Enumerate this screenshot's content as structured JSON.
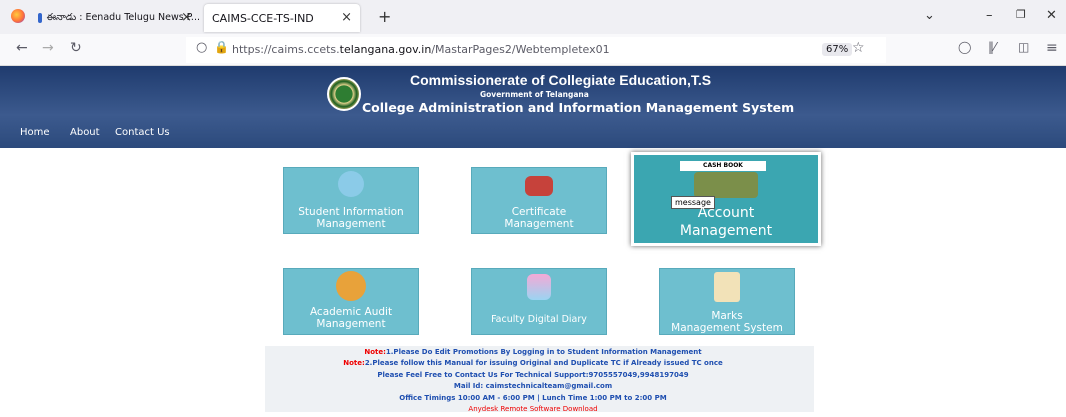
{
  "browser": {
    "tabs": [
      {
        "label": "ఈనాడు : Eenadu Telugu News P...",
        "close": "×"
      },
      {
        "label": "CAIMS-CCE-TS-IND",
        "close": "×"
      }
    ],
    "new_tab": "+",
    "url_host": "https://caims.ccets.",
    "url_domain": "telangana.gov.in",
    "url_path": "/MastarPages2/Webtempletex01",
    "zoom": "67%"
  },
  "header": {
    "title": "Commissionerate of Collegiate Education,T.S",
    "subtitle": "Government of Telangana",
    "system": "College Administration and Information Management System"
  },
  "menu": [
    "Home",
    "About",
    "Contact Us"
  ],
  "tiles": {
    "student": [
      "Student Information",
      "Management"
    ],
    "certificate": [
      "Certificate",
      "Management"
    ],
    "account": {
      "badge": "CASH BOOK",
      "tooltip": "message",
      "lines": [
        "Account",
        "Management"
      ]
    },
    "academic": [
      "Academic Audit",
      "Management"
    ],
    "diary": "Faculty Digital Diary",
    "marks": [
      "Marks",
      "Management System"
    ]
  },
  "notes": {
    "n1_label": "Note:",
    "n1": "1.Please Do Edit Promotions By Logging in to Student Information Management",
    "n2_label": "Note:",
    "n2": "2.Please follow this Manual for issuing Original and Duplicate TC if Already issued TC once",
    "support": "Please Feel Free to Contact Us For Technical Support:9705557049,9948197049",
    "mail": "Mail Id: caimstechnicalteam@gmail.com",
    "timings": "Office Timings 10:00 AM - 6:00 PM | Lunch Time 1:00 PM to 2:00 PM",
    "anydesk": "Anydesk Remote Software Download"
  }
}
